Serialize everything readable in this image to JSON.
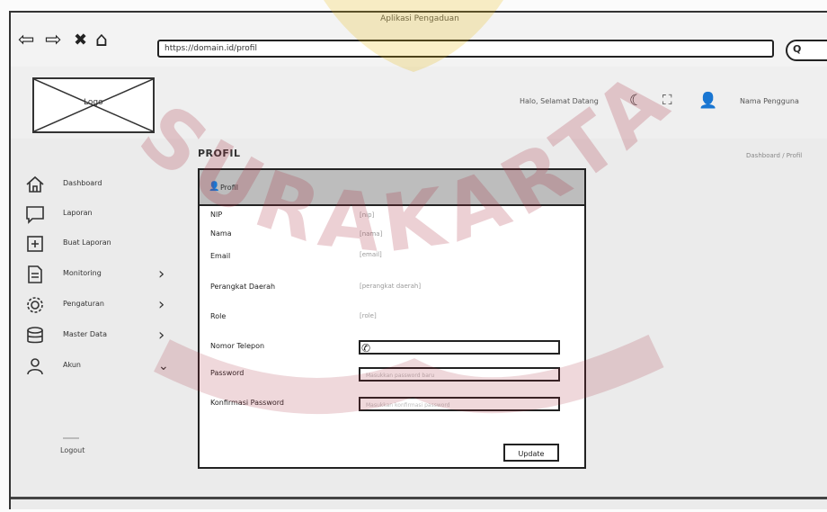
{
  "window": {
    "title": "Aplikasi Pengaduan"
  },
  "browser": {
    "url": "https://domain.id/profil",
    "search_glyph": "Q",
    "icons": {
      "back": "arrow-left-icon",
      "forward": "arrow-right-icon",
      "close": "close-icon",
      "home": "home-icon",
      "search": "search-icon"
    }
  },
  "header": {
    "logo_text": "Logo",
    "welcome": "Halo, Selamat Datang",
    "username": "Nama Pengguna",
    "icons": [
      "moon-icon",
      "fullscreen-icon",
      "user-icon"
    ]
  },
  "sidebar": {
    "items": [
      {
        "label": "Dashboard",
        "icon": "home-icon",
        "has_chevron": false
      },
      {
        "label": "Laporan",
        "icon": "chat-icon",
        "has_chevron": false
      },
      {
        "label": "Buat Laporan",
        "icon": "add-icon",
        "has_chevron": false
      },
      {
        "label": "Monitoring",
        "icon": "document-icon",
        "has_chevron": true
      },
      {
        "label": "Pengaturan",
        "icon": "gear-icon",
        "has_chevron": true
      },
      {
        "label": "Master Data",
        "icon": "database-icon",
        "has_chevron": true
      },
      {
        "label": "Akun",
        "icon": "user-icon",
        "has_chevron": true
      }
    ],
    "logout": "Logout"
  },
  "page": {
    "title": "PROFIL",
    "breadcrumb": "Dashboard / Profil"
  },
  "profile_card": {
    "header": "Profil",
    "fields": [
      {
        "label": "NIP",
        "value": "[nip]"
      },
      {
        "label": "Nama",
        "value": "[nama]"
      },
      {
        "label": "Email",
        "value": "[email]"
      },
      {
        "label": "Perangkat Daerah",
        "value": "[perangkat daerah]"
      },
      {
        "label": "Role",
        "value": "[role]"
      }
    ],
    "inputs": [
      {
        "label": "Nomor Telepon",
        "placeholder": ""
      },
      {
        "label": "Password",
        "placeholder": "Masukkan password baru"
      },
      {
        "label": "Konfirmasi Password",
        "placeholder": "Masukkan konfirmasi password"
      }
    ],
    "update_label": "Update"
  },
  "watermark": {
    "text": "SURAKARTA",
    "color": "#a8283a"
  },
  "colors": {
    "accent": "#a8283a",
    "gold": "#e6b400"
  }
}
